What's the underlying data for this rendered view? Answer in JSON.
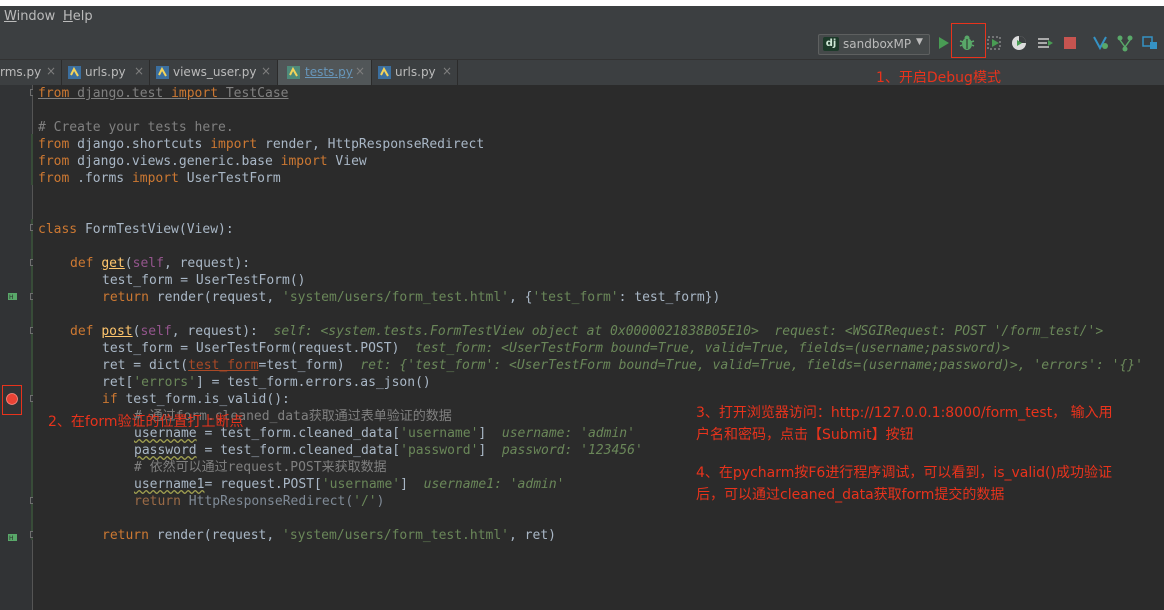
{
  "menu": {
    "window": "Window",
    "window_mn": "W",
    "window_rest": "indow",
    "help": "Help",
    "help_mn": "H",
    "help_rest": "elp"
  },
  "toolbar": {
    "run_config": "sandboxMP",
    "icons": [
      "run-icon",
      "debug-icon",
      "coverage-icon",
      "profile-icon",
      "concurrency-icon",
      "stop-icon",
      "vcs-update-icon",
      "vcs-branch-icon",
      "project-structure-icon"
    ]
  },
  "tabs": [
    {
      "label": "rms.py"
    },
    {
      "label": "urls.py"
    },
    {
      "label": "views_user.py"
    },
    {
      "label": "tests.py",
      "active": true
    },
    {
      "label": "urls.py"
    }
  ],
  "code": {
    "l1_from": "from",
    "l1_mod": " django.test ",
    "l1_imp": "import",
    "l1_name": " TestCase",
    "l3": "# Create your tests here.",
    "l4_from": "from",
    "l4_mod": " django.shortcuts ",
    "l4_imp": "import",
    "l4_names": " render, HttpResponseRedirect",
    "l5_from": "from",
    "l5_mod": " django.views.generic.base ",
    "l5_imp": "import",
    "l5_names": " View",
    "l6_from": "from",
    "l6_mod": " .forms ",
    "l6_imp": "import",
    "l6_names": " UserTestForm",
    "l9_class": "class",
    "l9_rest": " FormTestView(View):",
    "l11_def": "def ",
    "l11_name": "get",
    "l11_p1": "(",
    "l11_self": "self",
    "l11_p2": ", request):",
    "l12": "test_form = UserTestForm()",
    "l13_ret": "return",
    "l13_a": " render(request, ",
    "l13_s1": "'system/users/form_test.html'",
    "l13_b": ", {",
    "l13_s2": "'test_form'",
    "l13_c": ": test_form})",
    "l15_def": "def ",
    "l15_name": "post",
    "l15_p1": "(",
    "l15_self": "self",
    "l15_p2": ", request):",
    "l15_hint": "self: <system.tests.FormTestView object at 0x0000021838B05E10>  request: <WSGIRequest: POST '/form_test/'>",
    "l16_code": "test_form = UserTestForm(request.POST)",
    "l16_hint": "test_form: <UserTestForm bound=True, valid=True, fields=(username;password)>",
    "l17_a": "ret = dict(",
    "l17_param": "test_form",
    "l17_b": "=test_form)",
    "l17_hint": "ret: {'test_form': <UserTestForm bound=True, valid=True, fields=(username;password)>, 'errors': '{}'",
    "l18_a": "ret[",
    "l18_s": "'errors'",
    "l18_b": "] = test_form.errors.as_json()",
    "l19_if": "if",
    "l19_rest": " test_form.is_valid():",
    "l20": "# 通过form.cleaned_data获取通过表单验证的数据",
    "l21_a": "username",
    "l21_b": " = test_form.cleaned_data[",
    "l21_s": "'username'",
    "l21_c": "]",
    "l21_hint": "username: 'admin'",
    "l22_a": "password",
    "l22_b": " = test_form.cleaned_data[",
    "l22_s": "'password'",
    "l22_c": "]",
    "l22_hint": "password: '123456'",
    "l23": "# 依然可以通过request.POST来获取数据",
    "l24_a": "username1",
    "l24_b": "= request.POST[",
    "l24_s": "'username'",
    "l24_c": "]",
    "l24_hint": "username1: 'admin'",
    "l25_ret": "return",
    "l25_a": " HttpResponseRedirect(",
    "l25_s": "'/'",
    "l25_b": ")",
    "l27_ret": "return",
    "l27_a": " render(request, ",
    "l27_s": "'system/users/form_test.html'",
    "l27_b": ", ret)"
  },
  "annotations": {
    "a1": "1、开启Debug模式",
    "a2": "2、在form验证的位置打上断点",
    "a3_l1": "3、打开浏览器访问：http://127.0.0.1:8000/form_test， 输入用",
    "a3_l2": "户名和密码，点击【Submit】按钮",
    "a4_l1": "4、在pycharm按F6进行程序调试，可以看到，is_valid()成功验证",
    "a4_l2": "后，可以通过cleaned_data获取form提交的数据"
  },
  "colors": {
    "annotation": "#e8331c",
    "highlight": "#2d5f97",
    "keyword": "#cc7832",
    "string": "#6a8759"
  }
}
